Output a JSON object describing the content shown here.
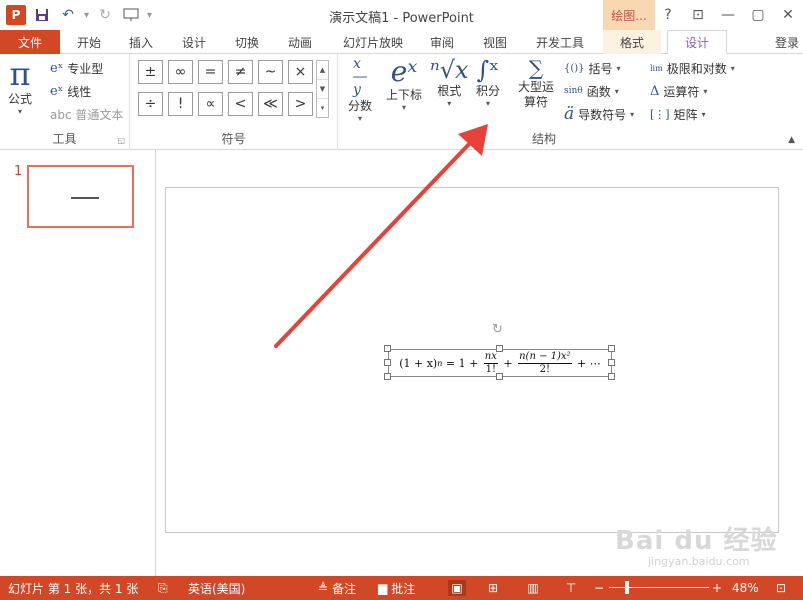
{
  "titlebar": {
    "logo": "P",
    "title": "演示文稿1 - PowerPoint",
    "contextual": "绘图...",
    "help": "?",
    "minimize": "—",
    "restore": "▢",
    "close": "✕",
    "ribbon_display": "⊡"
  },
  "tabs": {
    "file": "文件",
    "home": "开始",
    "insert": "插入",
    "design": "设计",
    "transitions": "切换",
    "animations": "动画",
    "slideshow": "幻灯片放映",
    "review": "审阅",
    "view": "视图",
    "developer": "开发工具",
    "format": "格式",
    "equation_design": "设计",
    "login": "登录"
  },
  "ribbon": {
    "tools": {
      "label": "工具",
      "equation": "公式",
      "equation_glyph": "π",
      "professional": "专业型",
      "linear": "线性",
      "normal_text": "abc 普通文本"
    },
    "symbols": {
      "label": "符号",
      "items": [
        "±",
        "∞",
        "=",
        "≠",
        "~",
        "×",
        "÷",
        "!",
        "∝",
        "<",
        "≪",
        ">"
      ]
    },
    "structures": {
      "label": "结构",
      "fraction": "分数",
      "script": "上下标",
      "radical": "根式",
      "integral": "积分",
      "large_operator": "大型运算符",
      "bracket": "括号",
      "function": "函数",
      "accent": "导数符号",
      "limit_log": "极限和对数",
      "operator": "运算符",
      "matrix": "矩阵"
    }
  },
  "thumbnails": {
    "slide_number": "1"
  },
  "equation": {
    "lhs": "(1 + x)",
    "exp_n": "n",
    "eq": " = 1 + ",
    "f1_num": "nx",
    "f1_den": "1!",
    "plus": " + ",
    "f2_num": "n(n − 1)x²",
    "f2_den": "2!",
    "tail": " + ⋯"
  },
  "watermark": {
    "brand": "Bai du 经验",
    "url": "jingyan.baidu.com"
  },
  "statusbar": {
    "slide_info": "幻灯片 第 1 张，共 1 张",
    "language": "英语(美国)",
    "notes": "备注",
    "comments": "批注",
    "zoom": "48%",
    "zoom_percent": 48
  },
  "colors": {
    "accent": "#d24726",
    "annotation_arrow": "#e8413a"
  }
}
